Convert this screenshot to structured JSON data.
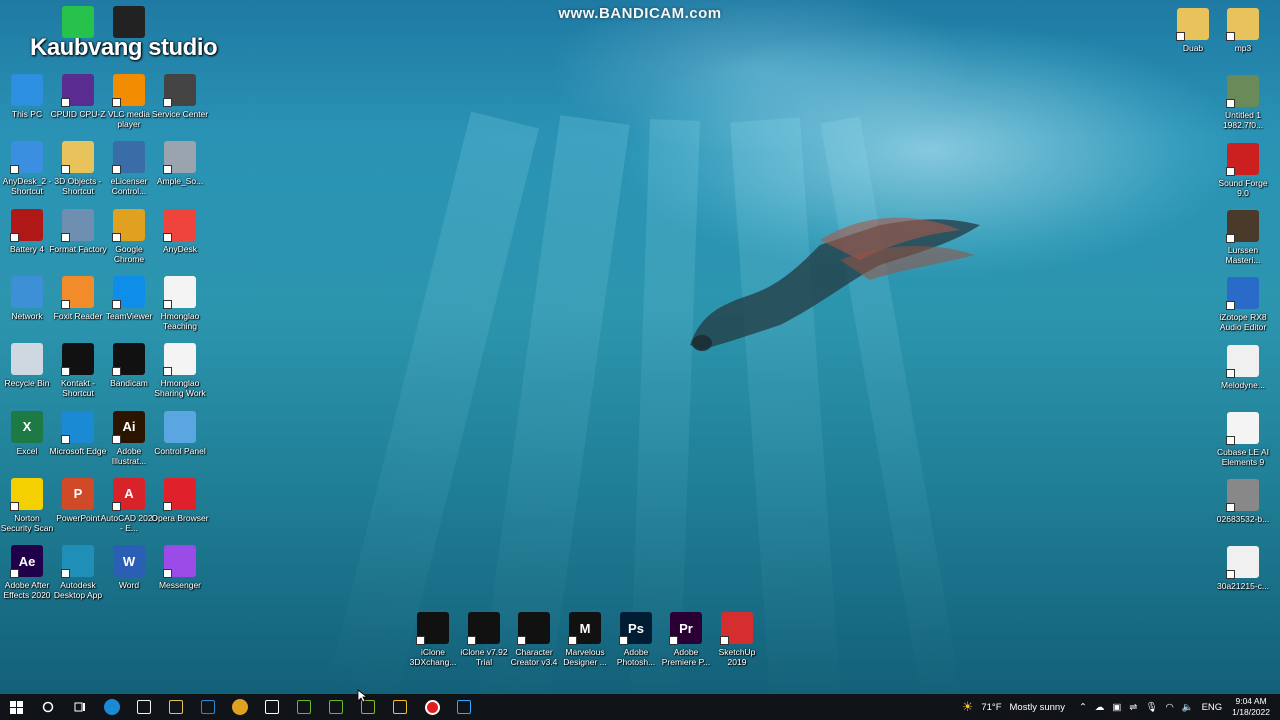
{
  "overlay": {
    "watermark": "www.BANDICAM.com",
    "studio": "Kaubvang studio"
  },
  "desktop_left": [
    {
      "label": "This PC",
      "icon": "computer-icon",
      "color": "#2d8fe0"
    },
    {
      "label": "CPUID CPU-Z",
      "icon": "cpu-chip-icon",
      "color": "#5b2c8f"
    },
    {
      "label": "VLC media player",
      "icon": "vlc-cone-icon",
      "color": "#f28c00"
    },
    {
      "label": "Service Center",
      "icon": "service-gauge-icon",
      "color": "#444444"
    },
    {
      "label": "AnyDesk_2 - Shortcut",
      "icon": "anydesk-window-icon",
      "color": "#3b8fe0"
    },
    {
      "label": "3D Objects - Shortcut",
      "icon": "folder-3d-icon",
      "color": "#e8c25a"
    },
    {
      "label": "eLicenser Control...",
      "icon": "usb-key-icon",
      "color": "#3a6ca8"
    },
    {
      "label": "Ample_So...",
      "icon": "film-reel-icon",
      "color": "#9aa4ae"
    },
    {
      "label": "Battery 4",
      "icon": "battery-power-icon",
      "color": "#b01818"
    },
    {
      "label": "Format Factory",
      "icon": "format-factory-icon",
      "color": "#6f8fb0"
    },
    {
      "label": "Google Chrome",
      "icon": "chrome-icon",
      "color": "#e0a020"
    },
    {
      "label": "AnyDesk",
      "icon": "anydesk-diamond-icon",
      "color": "#ef443b"
    },
    {
      "label": "Network",
      "icon": "network-globe-icon",
      "color": "#3d8fd6"
    },
    {
      "label": "Foxit Reader",
      "icon": "pdf-reader-icon",
      "color": "#f28c2a"
    },
    {
      "label": "TeamViewer",
      "icon": "teamviewer-icon",
      "color": "#0e8ee9"
    },
    {
      "label": "Hmonglao Teaching",
      "icon": "hmonglao-logo-icon",
      "color": "#f4f4f4"
    },
    {
      "label": "Recycle Bin",
      "icon": "recycle-bin-icon",
      "color": "#cfd8e0"
    },
    {
      "label": "Kontakt - Shortcut",
      "icon": "kontakt-icon",
      "color": "#111111"
    },
    {
      "label": "Bandicam",
      "icon": "bandicam-record-icon",
      "color": "#111111"
    },
    {
      "label": "Hmonglao Sharing Work",
      "icon": "hmonglao-sharing-icon",
      "color": "#f4f4f4"
    },
    {
      "label": "Excel",
      "icon": "excel-icon",
      "color": "#1d7a45",
      "glyph": "X"
    },
    {
      "label": "Microsoft Edge",
      "icon": "edge-icon",
      "color": "#1a8ad4"
    },
    {
      "label": "Adobe Illustrat...",
      "icon": "illustrator-icon",
      "color": "#2b1500",
      "glyph": "Ai"
    },
    {
      "label": "Control Panel",
      "icon": "control-panel-icon",
      "color": "#5aa6e0"
    },
    {
      "label": "Norton Security Scan",
      "icon": "norton-icon",
      "color": "#f5d000"
    },
    {
      "label": "PowerPoint",
      "icon": "powerpoint-icon",
      "color": "#d04a27",
      "glyph": "P"
    },
    {
      "label": "AutoCAD 2020 - E...",
      "icon": "autocad-icon",
      "color": "#d8232a",
      "glyph": "A"
    },
    {
      "label": "Opera Browser",
      "icon": "opera-icon",
      "color": "#e0202a"
    },
    {
      "label": "Adobe After Effects 2020",
      "icon": "after-effects-icon",
      "color": "#20004a",
      "glyph": "Ae"
    },
    {
      "label": "Autodesk Desktop App",
      "icon": "autodesk-icon",
      "color": "#1f8fb8"
    },
    {
      "label": "Word",
      "icon": "word-icon",
      "color": "#2a5fb5",
      "glyph": "W"
    },
    {
      "label": "Messenger",
      "icon": "messenger-icon",
      "color": "#9b4be8"
    }
  ],
  "desktop_top_extra": [
    {
      "label": "",
      "icon": "whatsapp-icon",
      "color": "#27c24c"
    },
    {
      "label": "",
      "icon": "ad-logo-icon",
      "color": "#222222"
    }
  ],
  "desktop_bottom": [
    {
      "label": "iClone 3DXchang...",
      "icon": "iclone-3dxchange-icon",
      "color": "#111111"
    },
    {
      "label": "iClone v7.92 Trial",
      "icon": "iclone-icon",
      "color": "#111111"
    },
    {
      "label": "Character Creator v3.4",
      "icon": "character-creator-icon",
      "color": "#111111"
    },
    {
      "label": "Marvelous Designer ...",
      "icon": "marvelous-designer-icon",
      "color": "#111111",
      "glyph": "M"
    },
    {
      "label": "Adobe Photosh...",
      "icon": "photoshop-icon",
      "color": "#001d34",
      "glyph": "Ps"
    },
    {
      "label": "Adobe Premiere P...",
      "icon": "premiere-icon",
      "color": "#2a0034",
      "glyph": "Pr"
    },
    {
      "label": "SketchUp 2019",
      "icon": "sketchup-icon",
      "color": "#d62e2e"
    }
  ],
  "desktop_right": [
    {
      "label": "Duab",
      "icon": "folder-icon",
      "color": "#e8c25a"
    },
    {
      "label": "mp3",
      "icon": "music-folder-icon",
      "color": "#e8c25a"
    },
    {
      "label": "Untitled 1 1982.7f0...",
      "icon": "video-file-icon",
      "color": "#6a8a5a"
    },
    {
      "label": "Sound Forge 9.0",
      "icon": "sound-forge-icon",
      "color": "#cc1f1f"
    },
    {
      "label": "Lurssen Masteri...",
      "icon": "lurssen-knob-icon",
      "color": "#4a3a2a"
    },
    {
      "label": "iZotope RX8 Audio Editor",
      "icon": "izotope-icon",
      "color": "#2a6ac8"
    },
    {
      "label": "Melodyne...",
      "icon": "melodyne-icon",
      "color": "#f0f0f0"
    },
    {
      "label": "Cubase LE AI Elements 9",
      "icon": "cubase-icon",
      "color": "#f4f4f4"
    },
    {
      "label": "02683532-b...",
      "icon": "phone-image-icon",
      "color": "#888888"
    },
    {
      "label": "30a21215-c...",
      "icon": "image-file-icon",
      "color": "#f0f0f0"
    }
  ],
  "taskbar": {
    "apps": [
      {
        "name": "start-button",
        "icon": "windows-logo-icon",
        "color": "#ffffff"
      },
      {
        "name": "search-button",
        "icon": "search-circle-icon",
        "color": "#ffffff"
      },
      {
        "name": "task-view-button",
        "icon": "task-view-icon",
        "color": "#ffffff"
      },
      {
        "name": "taskbar-edge",
        "icon": "edge-icon",
        "color": "#1a8ad4"
      },
      {
        "name": "taskbar-store",
        "icon": "store-icon",
        "color": "#f2f2f2"
      },
      {
        "name": "taskbar-explorer",
        "icon": "folder-icon",
        "color": "#e8c25a"
      },
      {
        "name": "taskbar-mail",
        "icon": "mail-icon",
        "color": "#2a8ad4"
      },
      {
        "name": "taskbar-chrome",
        "icon": "chrome-icon",
        "color": "#e0a020"
      },
      {
        "name": "taskbar-cubase",
        "icon": "cubase-icon",
        "color": "#ffffff"
      },
      {
        "name": "taskbar-iclone-3dx",
        "icon": "iclone-3dxchange-icon",
        "color": "#6ab82a"
      },
      {
        "name": "taskbar-iclone",
        "icon": "iclone-icon",
        "color": "#6ab82a"
      },
      {
        "name": "taskbar-character-creator",
        "icon": "character-creator-icon",
        "color": "#8ab82a"
      },
      {
        "name": "taskbar-marvelous",
        "icon": "marvelous-designer-icon",
        "color": "#f0c020"
      },
      {
        "name": "taskbar-bandicam",
        "icon": "bandicam-record-icon",
        "color": "#e02020"
      },
      {
        "name": "taskbar-photoshop",
        "icon": "photoshop-icon",
        "color": "#31a8ff"
      }
    ],
    "weather_temp": "71°F",
    "weather_text": "Mostly sunny",
    "language": "ENG",
    "time": "9:04 AM",
    "date": "1/18/2022"
  }
}
